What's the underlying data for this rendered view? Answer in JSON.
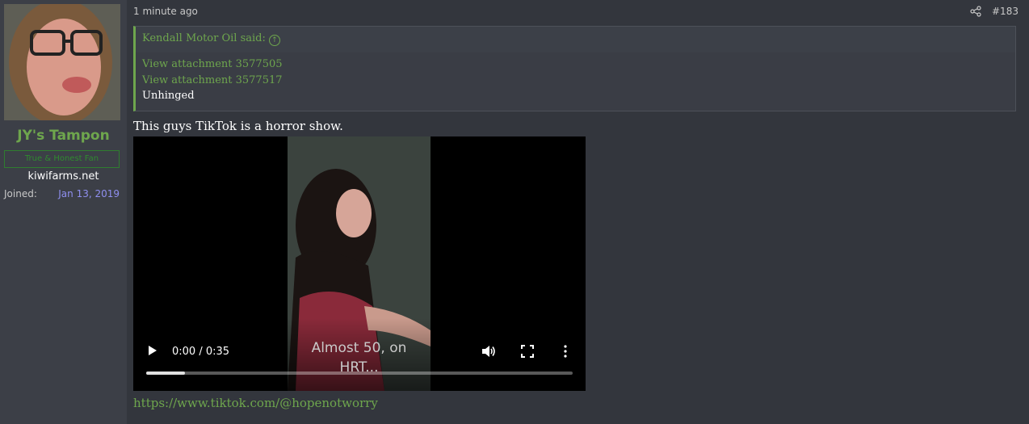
{
  "user": {
    "name": "JY's Tampon",
    "title": "True & Honest Fan",
    "subtitle": "kiwifarms.net",
    "joined_label": "Joined:",
    "joined_date": "Jan 13, 2019"
  },
  "post": {
    "time": "1 minute ago",
    "number": "#183",
    "quote": {
      "author": "Kendall Motor Oil said:",
      "links": [
        "View attachment 3577505",
        "View attachment 3577517"
      ],
      "text": "Unhinged"
    },
    "body_text": "This guys TikTok is a horror show.",
    "link": "https://www.tiktok.com/@hopenotworry"
  },
  "video": {
    "time_display": "0:00 / 0:35",
    "caption_line1": "Almost 50, on",
    "caption_line2": "HRT...",
    "progress": 0.09
  },
  "icons": {
    "share": "share-icon",
    "play": "play-icon",
    "volume": "volume-icon",
    "fullscreen": "fullscreen-icon",
    "more": "more-vertical-icon",
    "quote_up": "arrow-up-circle-icon"
  },
  "colors": {
    "accent": "#6ea64d",
    "background": "#33363d",
    "sidebar": "#3c3f47",
    "joined_date": "#8f8ff0"
  }
}
